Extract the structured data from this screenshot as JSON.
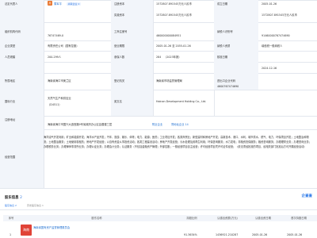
{
  "rows": {
    "legal_rep_label": "法定代表人",
    "legal_rep_avatar": "周",
    "legal_rep_name": "周军平",
    "legal_rep_badge": "关联企业 2",
    "reg_capital_label": "注册资本",
    "reg_capital_value": "1572807.891545万元人民币",
    "paid_capital_label": "实缴资本",
    "paid_capital_value": "1572807.891545万元人民币",
    "est_date_label": "成立日期",
    "est_date_value": "2005-01-26",
    "org_code_label": "组织机构代码",
    "org_code_value": "76747469-0",
    "reg_no_label": "工商注册号",
    "reg_no_value": "460000000084951",
    "tax_id_label": "纳税人识别号",
    "tax_id_value": "91460000767474690",
    "company_type_label": "企业类型",
    "company_type_value": "有限责任公司（国有控股）",
    "biz_term_label": "营业期限",
    "biz_term_value": "2005-01-26 至 2055-01-26",
    "taxpayer_label": "纳税人资质",
    "taxpayer_value": "增值税一般纳税人",
    "staff_label": "人员规模",
    "staff_value": "200-299人",
    "insured_label": "参保人数",
    "insured_value": "284",
    "insured_note": "（2023年报）",
    "approval_label": "核准日期",
    "approval_value": "2024-12-16",
    "region_label": "所属地区",
    "region_value": "海南省海口市美兰区",
    "authority_label": "登记机关",
    "authority_value": "海南省市场监督管理局",
    "ie_code_label": "进出口企业代码",
    "ie_code_value": "4600767474690",
    "industry_label": "国标行业",
    "industry_value": "天然气生产和供应业",
    "industry_code": "（D4511）",
    "en_name_label": "英文名",
    "en_name_value": "Hainan Development Holding Co., Ltd.",
    "address_label": "注册地址",
    "address_value": "海南省海口市国兴大道西路9号省政府办公区会展楼三层",
    "address_link1": "附近企业",
    "address_link2": "同地址企业 14",
    "scope_label": "经营范围",
    "scope_value": "海洋油气开发利用；矿业和能源开发；海洋水产品开发；汽车、旅游、娱乐、体育；电力、能源；医药；工业项目开发；各类商贸业；新型建材和房地产开发；高新技术、港口、水利、城市供水、燃气、电力、环保项目开发；土地整治和物流；土地整治服务；土地使用权租赁；房地产开发经营；以自有资金从事投资活动；各类工程建设活动；房地产开发经营；污水处理及其再生利用；环保咨询服务；水力发电；非融资担保服务；融资咨询服务；办理理财业务；办理咨询业务；办理税务业务；办理律师事务所业务；办理公证业务；办理会计业务；认证服务（不包括金融资产管理；外部控股；一般经营项目自主经营；许可经营项目凭许可证件经营；（依法须经批准的项目，经相关部门批准后方可开展经营活动）"
  },
  "section": {
    "title": "股东信息",
    "count": "2",
    "filter1": "股东信息 2",
    "filter2": "历史股东信息 1",
    "brand": "企查查"
  },
  "table": {
    "headers": [
      "序号",
      "股东名称",
      "持股比例",
      "认缴出资额(万元)",
      "认缴出资日期",
      "首次持股日期"
    ],
    "row1": {
      "index": "1",
      "logo": "海南",
      "name": "海南省国有资产监督管理委员会",
      "ratio": "91.3634%",
      "amount": "1436921.210287",
      "date": "2005-01-26",
      "first": "2005-01-26"
    }
  }
}
